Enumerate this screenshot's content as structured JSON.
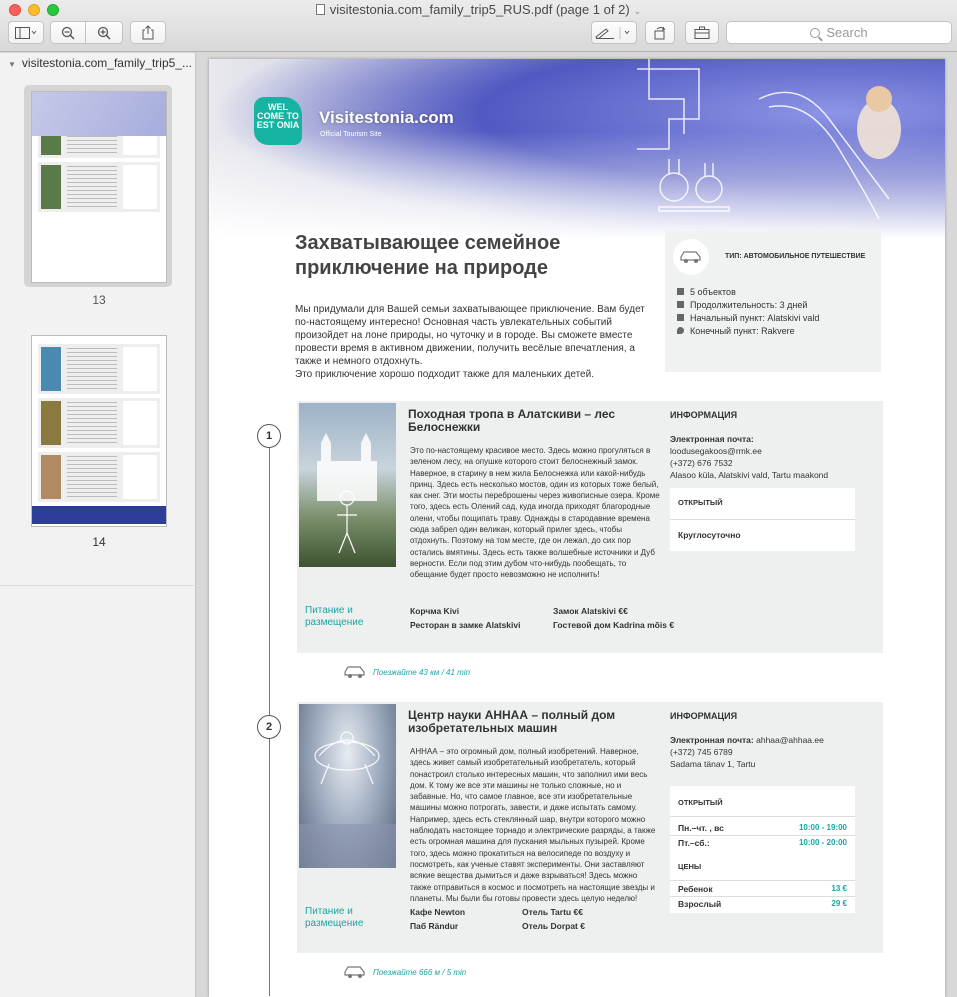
{
  "window": {
    "title": "visitestonia.com_family_trip5_RUS.pdf (page 1 of 2)",
    "search_placeholder": "Search"
  },
  "sidebar": {
    "doc_name": "visitestonia.com_family_trip5_...",
    "pages": [
      {
        "label": "13"
      },
      {
        "label": "14"
      }
    ]
  },
  "page": {
    "logo_text": "WEL COME TO EST ONIA",
    "brand": "Visitestonia.com",
    "brand_sub": "Official Tourism Site",
    "title": "Захватывающее семейное приключение на природе",
    "intro": "Мы придумали для Вашей семьи захватывающее приключение. Вам будет по-настоящему интересно! Основная часть увлекательных событий произойдет на лоне природы, но чуточку и в городе. Вы сможете вместе провести время в активном движении, получить весёлые впечатления, а также и немного отдохнуть.\nЭто приключение хорошо подходит также для маленьких детей.",
    "trip": {
      "type": "ТИП: АВТОМОБИЛЬНОЕ ПУТЕШЕСТВИЕ",
      "objects": "5 объектов",
      "duration": "Продолжительность: 3 дней",
      "start": "Начальный пункт: Alatskivi vald",
      "end": "Конечный пункт: Rakvere"
    },
    "stops": [
      {
        "num": "1",
        "title": "Походная тропа в Алатскиви – лес Белоснежки",
        "desc": "Это по-настоящему красивое место. Здесь можно прогуляться в зеленом лесу, на опушке которого стоит белоснежный замок. Наверное, в старину в нем жила Белоснежка или какой-нибудь принц. Здесь есть несколько мостов, один из которых тоже белый, как снег. Эти мосты переброшены через живописные озера. Кроме того, здесь есть Олений сад, куда иногда приходят благородные олени, чтобы пощипать траву. Однажды в стародавние времена сюда забрел один великан, который прилег здесь, чтобы отдохнуть. Поэтому на том месте, где он лежал, до сих пор остались вмятины. Здесь есть также волшебные источники и Дуб верности. Если под этим дубом что-нибудь пообещать, то обещание будет просто невозможно не исполнить!",
        "info_heading": "ИНФОРМАЦИЯ",
        "email_label": "Электронная почта:",
        "email": "loodusegakoos@rmk.ee",
        "phone": "(+372) 676 7532",
        "address": "Alasoo küla, Alatskivi vald, Tartu maakond",
        "open_label": "ОТКРЫТЫЙ",
        "hours": "Круглосуточно",
        "food_heading": "Питание и размещение",
        "food": [
          "Корчма Kivi",
          "Замок Alatskivi €€",
          "Ресторан в замке Alatskivi",
          "Гостевой дом Kadrina mõis €"
        ],
        "drive": "Поезжайте 43 км / 41 min"
      },
      {
        "num": "2",
        "title": "Центр науки АННАА – полный дом изобретательных машин",
        "desc": "АННАА – это огромный дом, полный изобретений. Наверное, здесь живет самый изобретательный изобретатель, который понастроил столько интересных машин, что заполнил ими весь дом. К тому же все эти машины не только сложные, но и забавные. Но, что самое главное, все эти изобретательные машины можно потрогать, завести, и даже испытать самому. Например, здесь есть  стеклянный шар, внутри которого можно наблюдать настоящее торнадо и электрические разряды, а также есть огромная машина для пускания мыльных пузырей. Кроме того, здесь можно прокатиться на велосипеде по воздуху и посмотреть, как ученые ставят эксперименты. Они заставляют всякие вещества дымиться и даже взрываться! Здесь можно также отправиться в космос и посмотреть на настоящие звезды и планеты. Мы были бы готовы провести здесь целую неделю!",
        "info_heading": "ИНФОРМАЦИЯ",
        "email_label": "Электронная почта:",
        "email": "ahhaa@ahhaa.ee",
        "phone": "(+372) 745 6789",
        "address": "Sadama tänav 1, Tartu",
        "open_label": "ОТКРЫТЫЙ",
        "hours_rows": [
          {
            "day": "Пн.–чт. , вс",
            "time": "10:00 - 19:00"
          },
          {
            "day": "Пт.–сб.:",
            "time": "10:00 - 20:00"
          }
        ],
        "prices_label": "ЦЕНЫ",
        "prices": [
          {
            "who": "Ребенок",
            "price": "13 €"
          },
          {
            "who": "Взрослый",
            "price": "29 €"
          }
        ],
        "food_heading": "Питание и размещение",
        "food": [
          "Кафе Newton",
          "Отель Tartu €€",
          "Паб Rändur",
          "Отель Dorpat €"
        ],
        "drive": "Поезжайте 666 м / 5 min"
      }
    ]
  }
}
